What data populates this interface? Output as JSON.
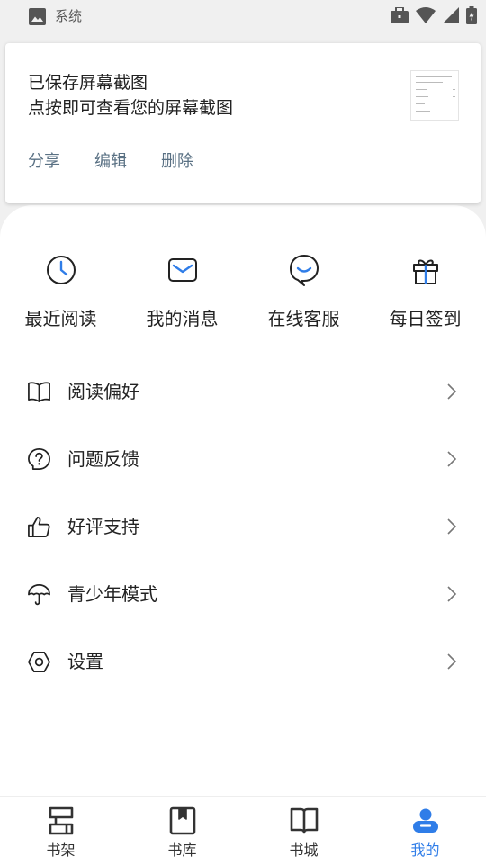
{
  "status_bar": {
    "app_name": "系统",
    "icons": [
      "gallery-icon",
      "briefcase-icon",
      "wifi-icon",
      "signal-icon",
      "battery-icon"
    ]
  },
  "notification": {
    "title": "已保存屏幕截图",
    "text": "点按即可查看您的屏幕截图",
    "actions": [
      {
        "label": "分享",
        "icon": null
      },
      {
        "label": "编辑",
        "icon": null
      },
      {
        "label": "删除",
        "icon": null
      }
    ],
    "action_color": "#5a7184"
  },
  "quick_actions": [
    {
      "label": "最近阅读",
      "icon": "clock-icon"
    },
    {
      "label": "我的消息",
      "icon": "envelope-icon"
    },
    {
      "label": "在线客服",
      "icon": "chat-smile-icon"
    },
    {
      "label": "每日签到",
      "icon": "gift-icon"
    }
  ],
  "quick_action_color": "#2f7de8",
  "menu": [
    {
      "label": "阅读偏好",
      "icon": "open-book-icon"
    },
    {
      "label": "问题反馈",
      "icon": "question-bubble-icon"
    },
    {
      "label": "好评支持",
      "icon": "thumbs-up-icon"
    },
    {
      "label": "青少年模式",
      "icon": "umbrella-icon"
    },
    {
      "label": "设置",
      "icon": "hexagon-gear-icon"
    }
  ],
  "bottom_nav": {
    "tabs": [
      {
        "label": "书架",
        "icon": "bookshelf-icon",
        "active": false
      },
      {
        "label": "书库",
        "icon": "bookmark-book-icon",
        "active": false
      },
      {
        "label": "书城",
        "icon": "open-book-icon",
        "active": false
      },
      {
        "label": "我的",
        "icon": "person-icon",
        "active": true
      }
    ],
    "active_color": "#2f7de8",
    "inactive_color": "#333333"
  }
}
